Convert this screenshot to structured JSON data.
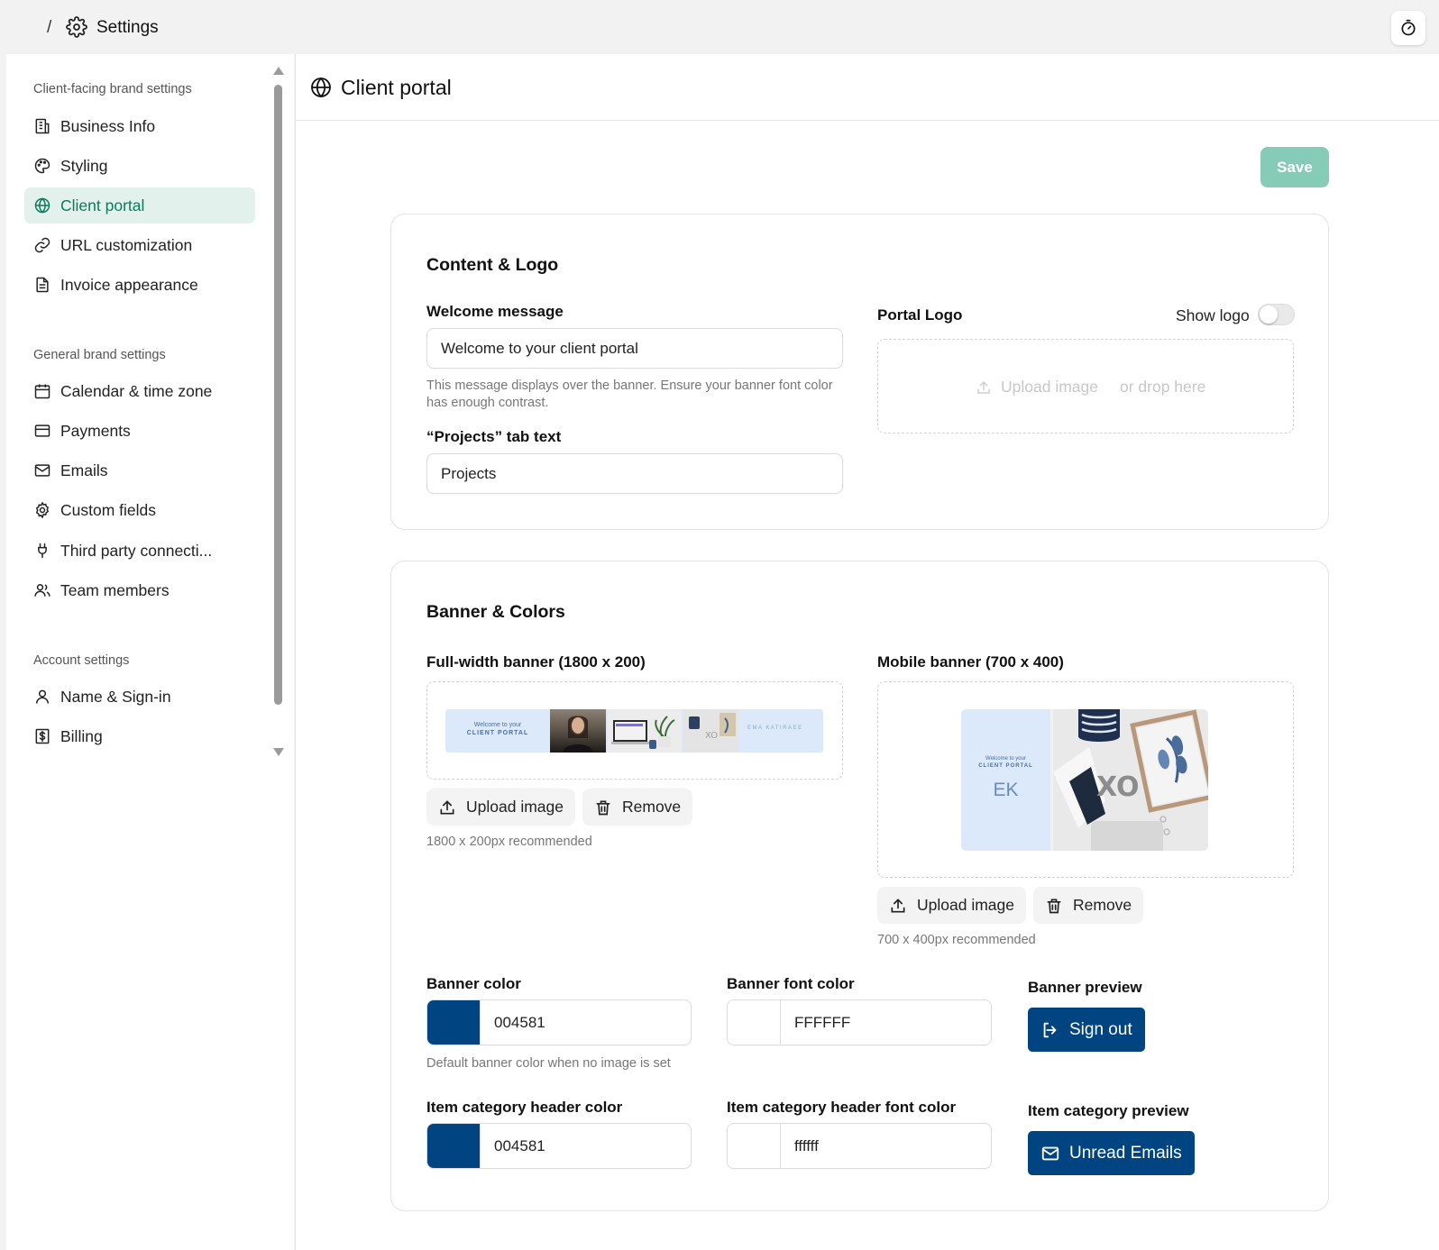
{
  "topbar": {
    "separator": "/",
    "title": "Settings",
    "settings_icon": "gear-icon",
    "timer_icon": "stopwatch-icon"
  },
  "sidebar": {
    "groups": [
      {
        "label": "Client-facing brand settings",
        "items": [
          {
            "label": "Business Info",
            "icon": "building-icon"
          },
          {
            "label": "Styling",
            "icon": "palette-icon"
          },
          {
            "label": "Client portal",
            "icon": "globe-icon",
            "active": true
          },
          {
            "label": "URL customization",
            "icon": "link-icon"
          },
          {
            "label": "Invoice appearance",
            "icon": "document-icon"
          }
        ]
      },
      {
        "label": "General brand settings",
        "items": [
          {
            "label": "Calendar & time zone",
            "icon": "calendar-icon"
          },
          {
            "label": "Payments",
            "icon": "credit-card-icon"
          },
          {
            "label": "Emails",
            "icon": "mail-icon"
          },
          {
            "label": "Custom fields",
            "icon": "gear-icon"
          },
          {
            "label": "Third party connecti...",
            "icon": "plug-icon"
          },
          {
            "label": "Team members",
            "icon": "users-icon"
          }
        ]
      },
      {
        "label": "Account settings",
        "items": [
          {
            "label": "Name & Sign-in",
            "icon": "user-icon"
          },
          {
            "label": "Billing",
            "icon": "dollar-icon"
          }
        ]
      }
    ]
  },
  "main": {
    "title": "Client portal",
    "save_label": "Save",
    "content_logo": {
      "title": "Content & Logo",
      "welcome_label": "Welcome message",
      "welcome_value": "Welcome to your client portal",
      "welcome_hint_line1": "This message displays over the banner. Ensure your banner font color",
      "welcome_hint_line2": "has enough contrast.",
      "projects_label": "“Projects” tab text",
      "projects_value": "Projects",
      "logo_label": "Portal Logo",
      "show_logo_label": "Show logo",
      "show_logo_on": false,
      "upload_label": "Upload image",
      "drop_label": "or drop here"
    },
    "banner_colors": {
      "title": "Banner & Colors",
      "full_banner_label": "Full-width banner (1800 x 200)",
      "full_banner_text1": "Welcome to your",
      "full_banner_text2": "CLIENT PORTAL",
      "full_banner_name": "EMA KATIRAEE",
      "full_upload": "Upload image",
      "full_remove": "Remove",
      "full_hint": "1800 x 200px recommended",
      "mobile_banner_label": "Mobile banner (700 x 400)",
      "mobile_banner_text1": "Welcome to your",
      "mobile_banner_text2": "CLIENT PORTAL",
      "mobile_banner_monogram": "EK",
      "mobile_banner_xo": "XO",
      "mobile_upload": "Upload image",
      "mobile_remove": "Remove",
      "mobile_hint": "700 x 400px recommended",
      "banner_color_label": "Banner color",
      "banner_color_value": "004581",
      "banner_color_hex": "#004581",
      "banner_color_hint": "Default banner color when no image is set",
      "banner_font_color_label": "Banner font color",
      "banner_font_color_value": "FFFFFF",
      "banner_font_color_hex": "#FFFFFF",
      "banner_preview_label": "Banner preview",
      "banner_preview_button": "Sign out",
      "item_header_color_label": "Item category header color",
      "item_header_color_value": "004581",
      "item_header_font_color_label": "Item category header font color",
      "item_header_font_color_value": "ffffff",
      "item_preview_label": "Item category preview",
      "item_preview_button": "Unread Emails"
    }
  },
  "colors": {
    "accent": "#0e7a5a",
    "active_bg": "#e2f1ec",
    "save_bg": "#85cbb5",
    "brand_blue": "#004581"
  }
}
